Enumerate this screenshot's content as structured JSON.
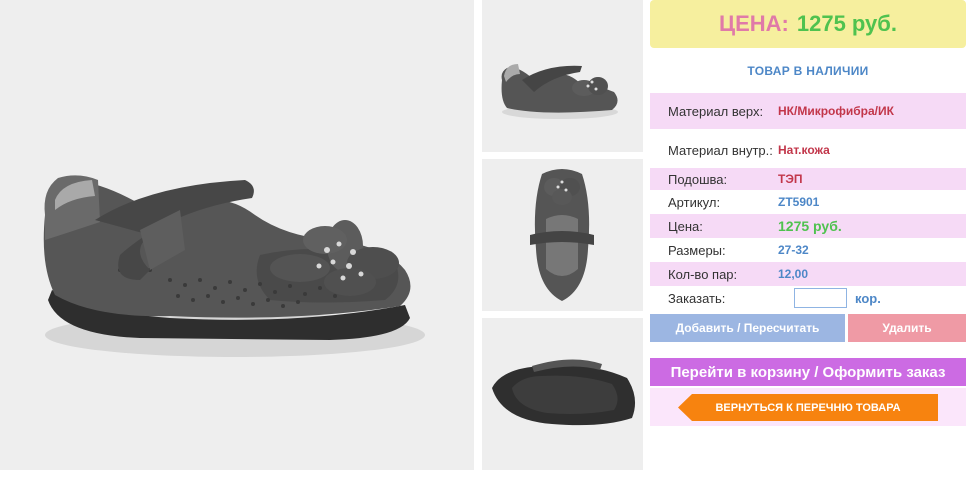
{
  "gallery": {
    "main_image": "shoe-side-view",
    "thumbnails": [
      "shoe-side-view-small",
      "shoe-top-view",
      "shoe-sole-view"
    ]
  },
  "price": {
    "label": "ЦЕНА:",
    "value": "1275 руб."
  },
  "stock_status": "ТОВАР В НАЛИЧИИ",
  "specs": [
    {
      "label": "Материал верх:",
      "value": "НК/Микрофибра/ИК"
    },
    {
      "label": "Материал внутр.:",
      "value": "Нат.кожа"
    },
    {
      "label": "Подошва:",
      "value": "ТЭП"
    },
    {
      "label": "Артикул:",
      "value": "ZT5901"
    },
    {
      "label": "Цена:",
      "value": "1275 руб."
    },
    {
      "label": "Размеры:",
      "value": "27-32"
    },
    {
      "label": "Кол-во пар:",
      "value": "12,00"
    }
  ],
  "order": {
    "label": "Заказать:",
    "value": "",
    "unit": "кор."
  },
  "buttons": {
    "add": "Добавить / Пересчитать",
    "delete": "Удалить",
    "cart": "Перейти в корзину / Оформить заказ",
    "back": "ВЕРНУТЬСЯ К ПЕРЕЧНЮ ТОВАРА"
  },
  "colors": {
    "price_label": "#e07aa8",
    "price_value": "#4fc24f",
    "accent_blue": "#4d87c7",
    "cart_button": "#cc6be3",
    "back_button": "#f7830f"
  }
}
